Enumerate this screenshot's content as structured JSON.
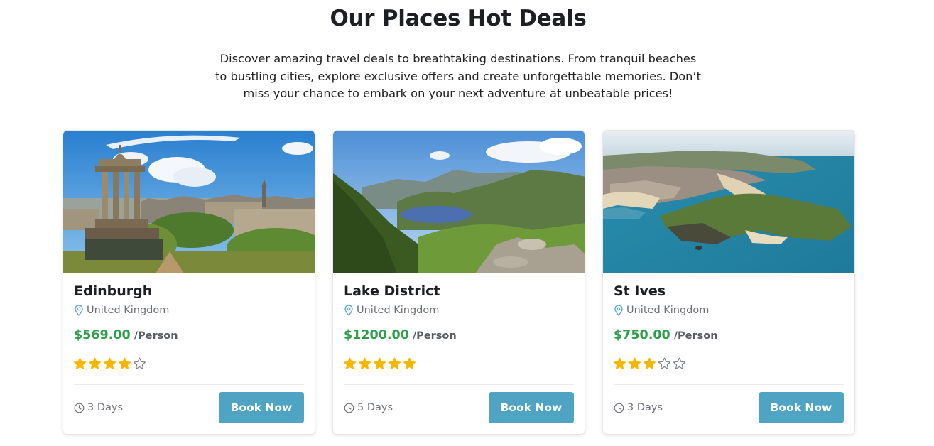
{
  "section": {
    "title": "Our Places Hot Deals",
    "description": "Discover amazing travel deals to breathtaking destinations. From tranquil beaches to bustling cities, explore exclusive offers and create unforgettable memories. Don’t miss your chance to embark on your next adventure at unbeatable prices!"
  },
  "colors": {
    "price": "#2e9e4a",
    "star": "#f5b800",
    "button": "#4ea4c2"
  },
  "deals": [
    {
      "name": "Edinburgh",
      "location": "United Kingdom",
      "price": "$569.00",
      "price_unit": "/Person",
      "rating": 4,
      "rating_max": 5,
      "duration": "3 Days",
      "button_label": "Book Now",
      "image": "edinburgh-monument-cityscape"
    },
    {
      "name": "Lake District",
      "location": "United Kingdom",
      "price": "$1200.00",
      "price_unit": "/Person",
      "rating": 5,
      "rating_max": 5,
      "duration": "5 Days",
      "button_label": "Book Now",
      "image": "lake-district-mountain-lake"
    },
    {
      "name": "St Ives",
      "location": "United Kingdom",
      "price": "$750.00",
      "price_unit": "/Person",
      "rating": 3,
      "rating_max": 5,
      "duration": "3 Days",
      "button_label": "Book Now",
      "image": "st-ives-coastal-town"
    }
  ]
}
